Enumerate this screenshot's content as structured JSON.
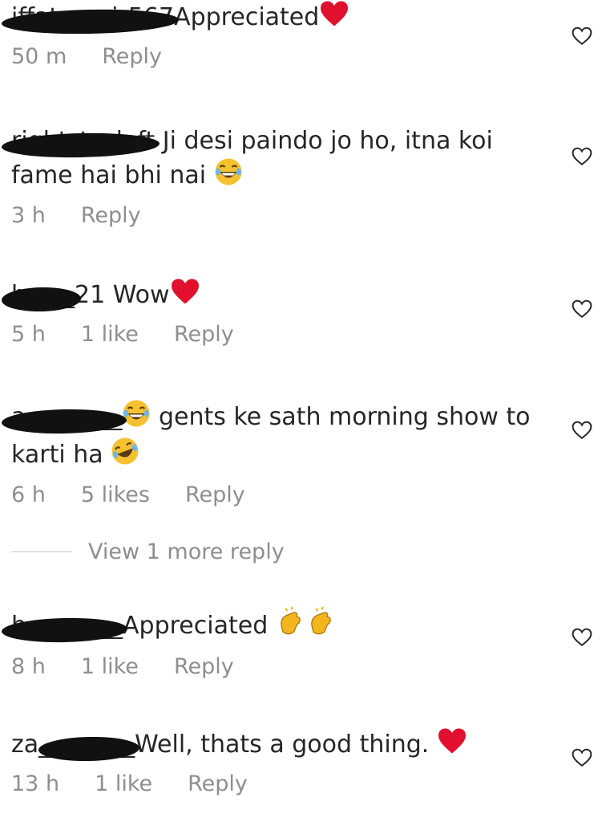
{
  "comments": [
    {
      "user": "iffataamir567",
      "text": "Appreciated",
      "emoji": "red-heart",
      "time": "50 m",
      "likes": "",
      "reply": "Reply"
    },
    {
      "user": "right_to_left",
      "text": "Ji desi paindo jo ho, itna koi fame hai bhi nai",
      "emoji": "laughing-face",
      "time": "3 h",
      "likes": "",
      "reply": "Reply"
    },
    {
      "user": "h____21",
      "text": "Wow",
      "emoji": "red-heart",
      "time": "5 h",
      "likes": "1 like",
      "reply": "Reply"
    },
    {
      "user": "a________",
      "text": "gents ke sath morning show to karti ha",
      "emoji": "laughing-face",
      "time": "6 h",
      "likes": "5 likes",
      "reply": "Reply"
    },
    {
      "user": "h________",
      "text": "Appreciated",
      "emoji": "clapping-hands",
      "time": "8 h",
      "likes": "1 like",
      "reply": "Reply"
    },
    {
      "user": "za________",
      "text": "Well, thats a good thing.",
      "emoji": "red-heart",
      "time": "13 h",
      "likes": "1 like",
      "reply": "Reply"
    }
  ],
  "view_more": "View 1 more reply",
  "colors": {
    "text": "#262626",
    "meta": "#8e8e8e",
    "heart": "#e0102e"
  }
}
